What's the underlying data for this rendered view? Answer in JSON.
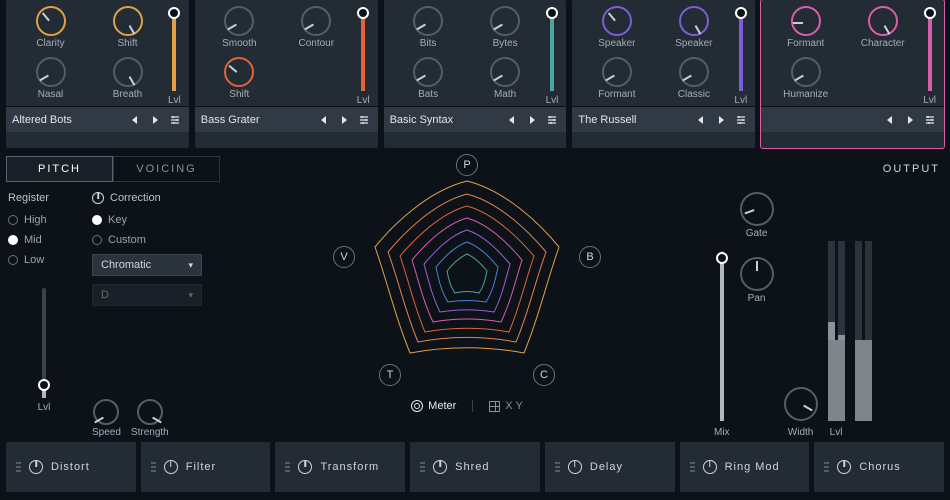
{
  "modules": [
    {
      "accent": "#e0a245",
      "knobs": [
        {
          "label": "Clarity",
          "rot": -40,
          "accent": true
        },
        {
          "label": "Shift",
          "rot": 150,
          "accent": true
        },
        {
          "label": "Nasal",
          "rot": -120
        },
        {
          "label": "Breath",
          "rot": 150
        }
      ],
      "lvl_label": "Lvl",
      "lvl_pct": 96,
      "preset": "Altered Bots"
    },
    {
      "accent": "#e2633a",
      "knobs": [
        {
          "label": "Smooth",
          "rot": -120
        },
        {
          "label": "Contour",
          "rot": -120
        },
        {
          "label": "Shift",
          "rot": -50,
          "accent": true
        },
        {
          "label": "",
          "rot": 0,
          "hidden": true
        }
      ],
      "lvl_label": "Lvl",
      "lvl_pct": 96,
      "preset": "Bass Grater"
    },
    {
      "accent": "#4aa6a0",
      "knobs": [
        {
          "label": "Bits",
          "rot": -120
        },
        {
          "label": "Bytes",
          "rot": -120
        },
        {
          "label": "Bats",
          "rot": -120
        },
        {
          "label": "Math",
          "rot": -120
        }
      ],
      "lvl_label": "Lvl",
      "lvl_pct": 96,
      "preset": "Basic Syntax"
    },
    {
      "accent": "#7b5fd8",
      "knobs": [
        {
          "label": "Speaker",
          "rot": -40,
          "accent": true
        },
        {
          "label": "Speaker",
          "rot": 150,
          "accent": true
        },
        {
          "label": "Formant",
          "rot": -120
        },
        {
          "label": "Classic",
          "rot": -120
        }
      ],
      "lvl_label": "Lvl",
      "lvl_pct": 96,
      "preset": "The Russell"
    },
    {
      "accent": "#d85fa8",
      "selected": true,
      "knobs": [
        {
          "label": "Formant",
          "rot": -90,
          "accent": true
        },
        {
          "label": "Character",
          "rot": 150,
          "accent": true
        },
        {
          "label": "Humanize",
          "rot": -120
        },
        {
          "label": "",
          "rot": 0,
          "hidden": true
        }
      ],
      "lvl_label": "Lvl",
      "lvl_pct": 96,
      "preset": ""
    }
  ],
  "tabs": {
    "pitch": "PITCH",
    "voicing": "VOICING",
    "active": "pitch"
  },
  "pitch": {
    "register_label": "Register",
    "register_options": [
      "High",
      "Mid",
      "Low"
    ],
    "register_value": "Mid",
    "correction_label": "Correction",
    "corr_options": [
      "Key",
      "Custom"
    ],
    "corr_value": "Key",
    "scale_value": "Chromatic",
    "root_value": "D",
    "lvl_label": "Lvl",
    "lvl_pct": 12,
    "speed_label": "Speed",
    "strength_label": "Strength"
  },
  "center": {
    "nodes": [
      "P",
      "B",
      "C",
      "T",
      "V"
    ],
    "meter_label": "Meter",
    "xy_label": "X Y"
  },
  "output": {
    "title": "OUTPUT",
    "gate_label": "Gate",
    "pan_label": "Pan",
    "mix_label": "Mix",
    "mix_pct": 96,
    "width_label": "Width",
    "lvl_label": "Lvl",
    "meter_l": 55,
    "meter_r": 48
  },
  "fx": [
    {
      "name": "Distort"
    },
    {
      "name": "Filter"
    },
    {
      "name": "Transform"
    },
    {
      "name": "Shred"
    },
    {
      "name": "Delay"
    },
    {
      "name": "Ring Mod"
    },
    {
      "name": "Chorus"
    }
  ]
}
